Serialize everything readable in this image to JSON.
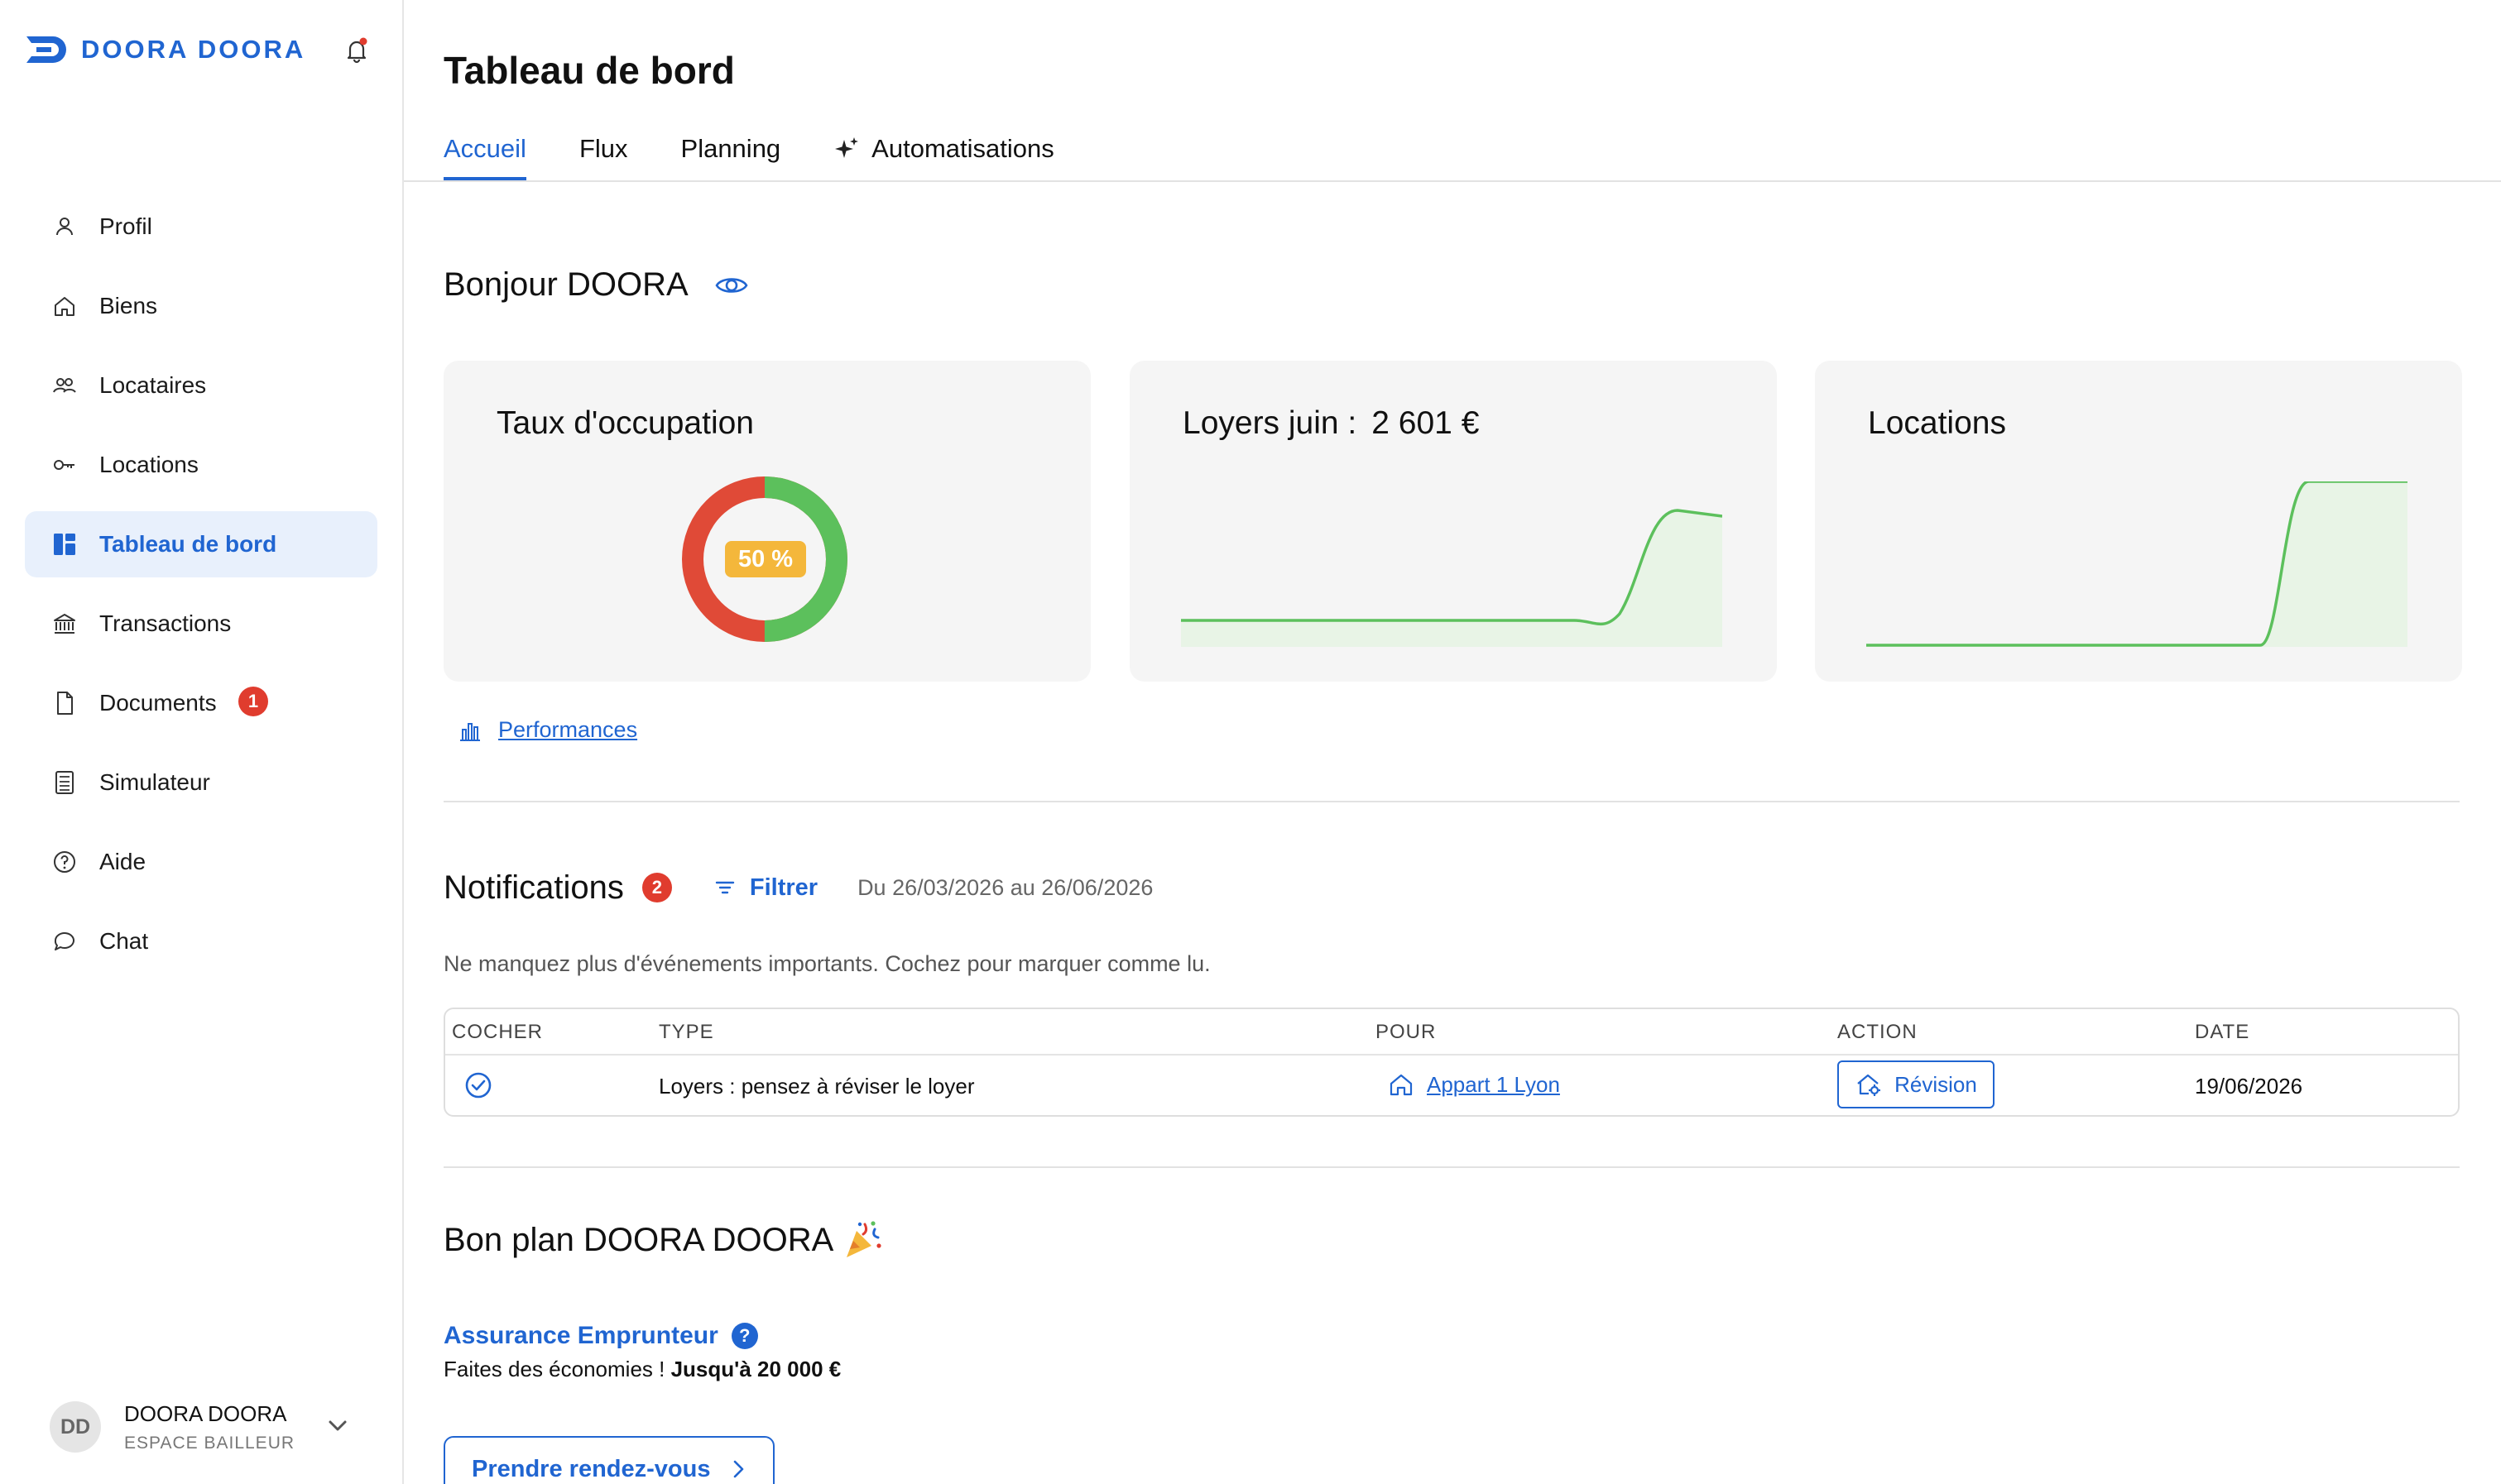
{
  "brand": {
    "name": "DOORA DOORA",
    "color": "#2065d1"
  },
  "sidebar": {
    "items": [
      {
        "label": "Profil",
        "icon": "user-icon"
      },
      {
        "label": "Biens",
        "icon": "home-icon"
      },
      {
        "label": "Locataires",
        "icon": "users-icon"
      },
      {
        "label": "Locations",
        "icon": "key-icon"
      },
      {
        "label": "Tableau de bord",
        "icon": "dashboard-icon",
        "active": true
      },
      {
        "label": "Transactions",
        "icon": "bank-icon"
      },
      {
        "label": "Documents",
        "icon": "document-icon",
        "badge": "1"
      },
      {
        "label": "Simulateur",
        "icon": "calculator-icon"
      },
      {
        "label": "Aide",
        "icon": "help-icon"
      },
      {
        "label": "Chat",
        "icon": "chat-icon"
      }
    ]
  },
  "user": {
    "initials": "DD",
    "name": "DOORA DOORA",
    "role": "ESPACE BAILLEUR"
  },
  "page": {
    "title": "Tableau de bord"
  },
  "tabs": [
    {
      "label": "Accueil",
      "active": true
    },
    {
      "label": "Flux"
    },
    {
      "label": "Planning"
    },
    {
      "label": "Automatisations",
      "icon": "sparkle-icon"
    }
  ],
  "greeting": "Bonjour DOORA",
  "cards": {
    "occupation": {
      "title": "Taux d'occupation",
      "value_label": "50 %",
      "percent": 50,
      "colors": {
        "filled": "#5cc05c",
        "empty": "#e04a37"
      }
    },
    "loyers": {
      "title": "Loyers juin :",
      "value": "2 601 €"
    },
    "locations": {
      "title": "Locations"
    }
  },
  "performances_link": "Performances",
  "notifications": {
    "title": "Notifications",
    "count": "2",
    "filter_label": "Filtrer",
    "date_range": "Du 26/03/2026 au 26/06/2026",
    "description": "Ne manquez plus d'événements importants. Cochez pour marquer comme lu.",
    "columns": [
      "COCHER",
      "TYPE",
      "POUR",
      "ACTION",
      "DATE"
    ],
    "rows": [
      {
        "type": "Loyers : pensez à réviser le loyer",
        "pour": "Appart 1 Lyon",
        "action": "Révision",
        "date": "19/06/2026"
      }
    ]
  },
  "bonplan": {
    "title": "Bon plan DOORA DOORA",
    "offer_title": "Assurance Emprunteur",
    "help_mark": "?",
    "economy_text": "Faites des économies ! ",
    "economy_bold": "Jusqu'à 20 000 €",
    "cta": "Prendre rendez-vous"
  }
}
